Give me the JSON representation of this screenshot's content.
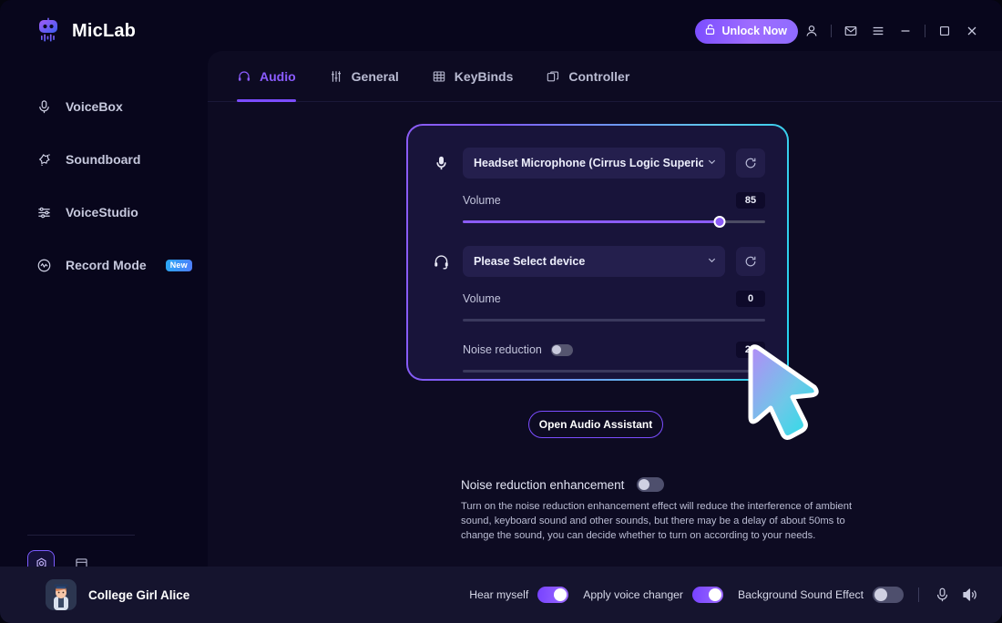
{
  "app": {
    "brand_name": "MicLab",
    "logo_icon": "robot-logo-icon"
  },
  "titlebar": {
    "unlock_label": "Unlock Now",
    "unlock_icon": "unlock-icon",
    "icons": [
      {
        "name": "account-icon",
        "glyph": "user"
      },
      {
        "name": "mail-icon",
        "glyph": "mail"
      },
      {
        "name": "menu-icon",
        "glyph": "hamburger"
      },
      {
        "name": "minimize-icon",
        "glyph": "minimize"
      },
      {
        "name": "maximize-icon",
        "glyph": "maximize"
      },
      {
        "name": "close-icon",
        "glyph": "close"
      }
    ]
  },
  "sidebar": {
    "items": [
      {
        "label": "VoiceBox",
        "icon": "microphone-icon",
        "badge": ""
      },
      {
        "label": "Soundboard",
        "icon": "sparkle-star-icon",
        "badge": ""
      },
      {
        "label": "VoiceStudio",
        "icon": "sliders-icon",
        "badge": ""
      },
      {
        "label": "Record Mode",
        "icon": "waveform-circle-icon",
        "badge": "New"
      }
    ],
    "tools": [
      {
        "name": "settings-icon",
        "active": true
      },
      {
        "name": "docs-icon",
        "active": false
      }
    ]
  },
  "tabs": [
    {
      "label": "Audio",
      "icon": "headset-icon",
      "active": true
    },
    {
      "label": "General",
      "icon": "sliders-icon",
      "active": false
    },
    {
      "label": "KeyBinds",
      "icon": "grid-icon",
      "active": false
    },
    {
      "label": "Controller",
      "icon": "windows-icon",
      "active": false
    }
  ],
  "audio": {
    "microphone": {
      "icon": "microphone-icon",
      "device": "Headset Microphone (Cirrus Logic Superior High De",
      "refresh_icon": "refresh-icon",
      "volume_label": "Volume",
      "volume_value": "85",
      "volume_percent": 85
    },
    "speaker": {
      "icon": "headset-icon",
      "device": "Please Select device",
      "refresh_icon": "refresh-icon",
      "volume_label": "Volume",
      "volume_value": "0",
      "volume_percent": 0,
      "noise_label": "Noise reduction",
      "noise_enabled": false,
      "noise_value": "25",
      "noise_percent": 0
    },
    "assistant_button": "Open Audio Assistant",
    "enhancement": {
      "title": "Noise reduction enhancement",
      "enabled": false,
      "description": "Turn on the noise reduction enhancement effect will reduce the interference of ambient sound, keyboard sound and other sounds, but there may be a delay of about 50ms to change the sound, you can decide whether to turn on according to your needs."
    }
  },
  "bottombar": {
    "voice_name": "College Girl Alice",
    "avatar_icon": "college-girl-avatar",
    "hear_myself_label": "Hear myself",
    "hear_myself_on": true,
    "voice_changer_label": "Apply voice changer",
    "voice_changer_on": true,
    "background_sound_label": "Background Sound Effect",
    "background_sound_on": false,
    "mic_icon": "microphone-icon",
    "speaker_icon": "speaker-icon"
  },
  "cursor": {
    "icon": "mouse-pointer-icon"
  },
  "colors": {
    "accent": "#7b4dff",
    "accent_light": "#8b5cf6",
    "cyan": "#22d3ee",
    "panel": "#0d0b22",
    "sidebar": "#08061c",
    "card": "#18143a"
  }
}
